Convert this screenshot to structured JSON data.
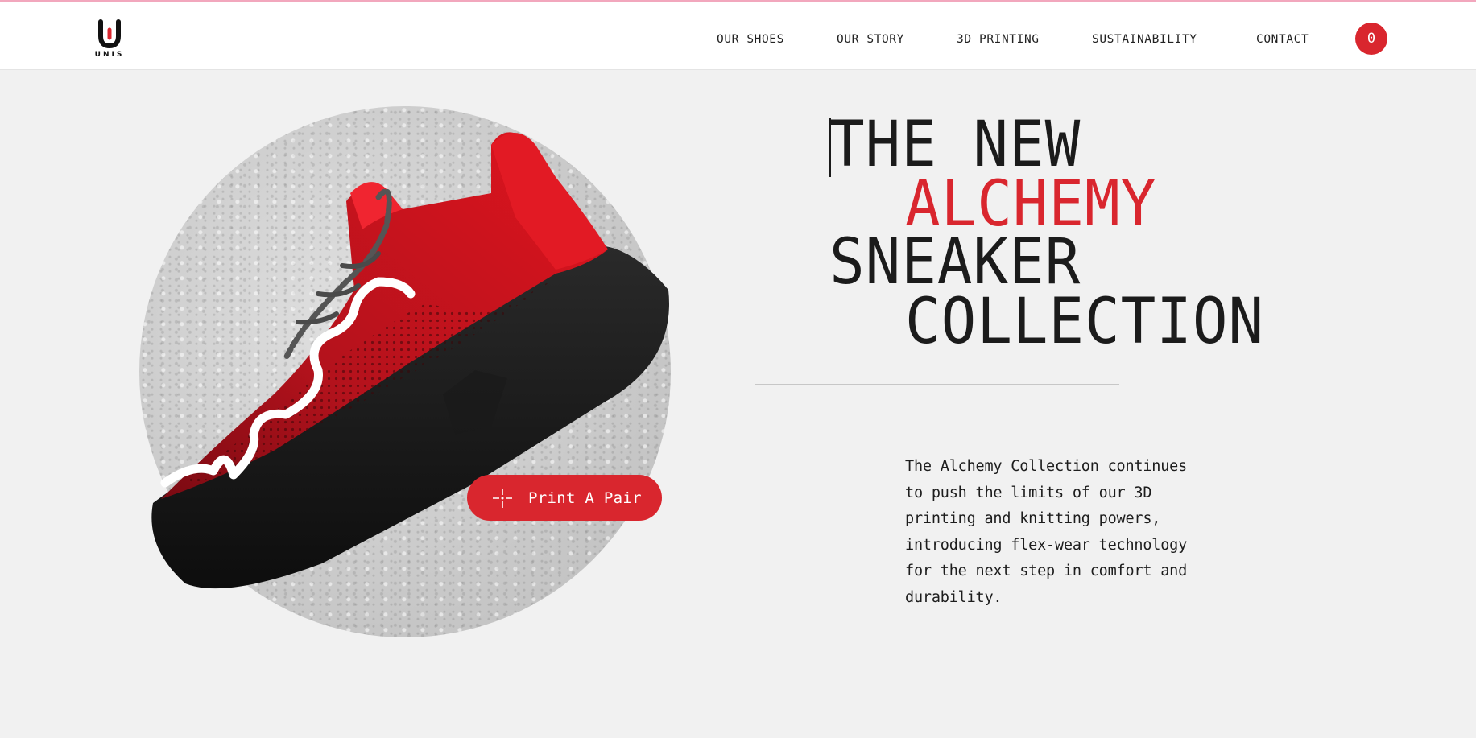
{
  "brand": {
    "logo_text": "UNIS"
  },
  "nav": {
    "items": [
      {
        "label": "OUR SHOES"
      },
      {
        "label": "OUR STORY"
      },
      {
        "label": "3D PRINTING"
      },
      {
        "label": "SUSTAINABILITY"
      },
      {
        "label": "CONTACT"
      }
    ],
    "cart_count": "0"
  },
  "hero": {
    "headline": {
      "line1": "THE NEW",
      "line2": "ALCHEMY",
      "line3": "SNEAKER",
      "line4": "COLLECTION"
    },
    "cta_label": "Print A Pair",
    "description": "The Alchemy Collection continues to push the limits of our 3D printing and knitting powers, introducing flex-wear technology for the next step in comfort and durability."
  },
  "colors": {
    "accent": "#d9262e",
    "background": "#f1f1f1",
    "top_border": "#f2a7bd"
  },
  "icons": [
    "unis-logo-icon",
    "crosshair-icon",
    "sneaker-image"
  ]
}
